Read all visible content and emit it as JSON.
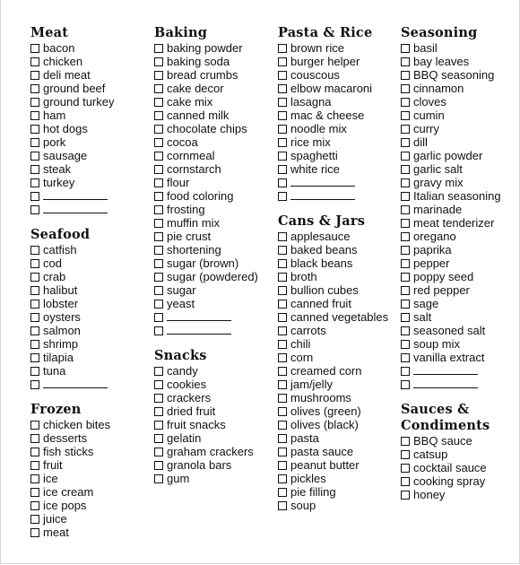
{
  "columns": [
    {
      "sections": [
        {
          "title": "Meat",
          "items": [
            "bacon",
            "chicken",
            "deli meat",
            "ground beef",
            "ground turkey",
            "ham",
            "hot dogs",
            "pork",
            "sausage",
            "steak",
            "turkey"
          ],
          "blank_lines": 2
        },
        {
          "title": "Seafood",
          "items": [
            "catfish",
            "cod",
            "crab",
            "halibut",
            "lobster",
            "oysters",
            "salmon",
            "shrimp",
            "tilapia",
            "tuna"
          ],
          "blank_lines": 1
        },
        {
          "title": "Frozen",
          "items": [
            "chicken bites",
            "desserts",
            "fish sticks",
            "fruit",
            "ice",
            "ice cream",
            "ice pops",
            "juice",
            "meat"
          ],
          "blank_lines": 0
        }
      ]
    },
    {
      "sections": [
        {
          "title": "Baking",
          "items": [
            "baking powder",
            "baking soda",
            "bread crumbs",
            "cake decor",
            "cake mix",
            "canned milk",
            "chocolate chips",
            "cocoa",
            "cornmeal",
            "cornstarch",
            "flour",
            "food coloring",
            "frosting",
            "muffin mix",
            "pie crust",
            "shortening",
            "sugar (brown)",
            "sugar (powdered)",
            "sugar",
            "yeast"
          ],
          "blank_lines": 2
        },
        {
          "title": "Snacks",
          "items": [
            "candy",
            "cookies",
            "crackers",
            "dried fruit",
            "fruit snacks",
            "gelatin",
            "graham crackers",
            "granola bars",
            "gum"
          ],
          "blank_lines": 0
        }
      ]
    },
    {
      "sections": [
        {
          "title": "Pasta & Rice",
          "items": [
            "brown rice",
            "burger helper",
            "couscous",
            "elbow macaroni",
            "lasagna",
            "mac & cheese",
            "noodle mix",
            "rice mix",
            "spaghetti",
            "white rice"
          ],
          "blank_lines": 2
        },
        {
          "title": "Cans & Jars",
          "items": [
            "applesauce",
            "baked beans",
            "black beans",
            "broth",
            "bullion cubes",
            "canned fruit",
            "canned vegetables",
            "carrots",
            "chili",
            "corn",
            "creamed corn",
            "jam/jelly",
            "mushrooms",
            "olives (green)",
            "olives (black)",
            "pasta",
            "pasta sauce",
            "peanut butter",
            "pickles",
            "pie filling",
            "soup"
          ],
          "blank_lines": 0
        }
      ]
    },
    {
      "sections": [
        {
          "title": "Seasoning",
          "items": [
            "basil",
            "bay leaves",
            "BBQ seasoning",
            "cinnamon",
            "cloves",
            "cumin",
            "curry",
            "dill",
            "garlic powder",
            "garlic salt",
            "gravy mix",
            "Italian seasoning",
            "marinade",
            "meat tenderizer",
            "oregano",
            "paprika",
            "pepper",
            "poppy seed",
            "red pepper",
            "sage",
            "salt",
            "seasoned salt",
            "soup mix",
            "vanilla extract"
          ],
          "blank_lines": 2
        },
        {
          "title": "Sauces & Condiments",
          "items": [
            "BBQ sauce",
            "catsup",
            "cocktail sauce",
            "cooking spray",
            "honey"
          ],
          "blank_lines": 0
        }
      ]
    }
  ]
}
